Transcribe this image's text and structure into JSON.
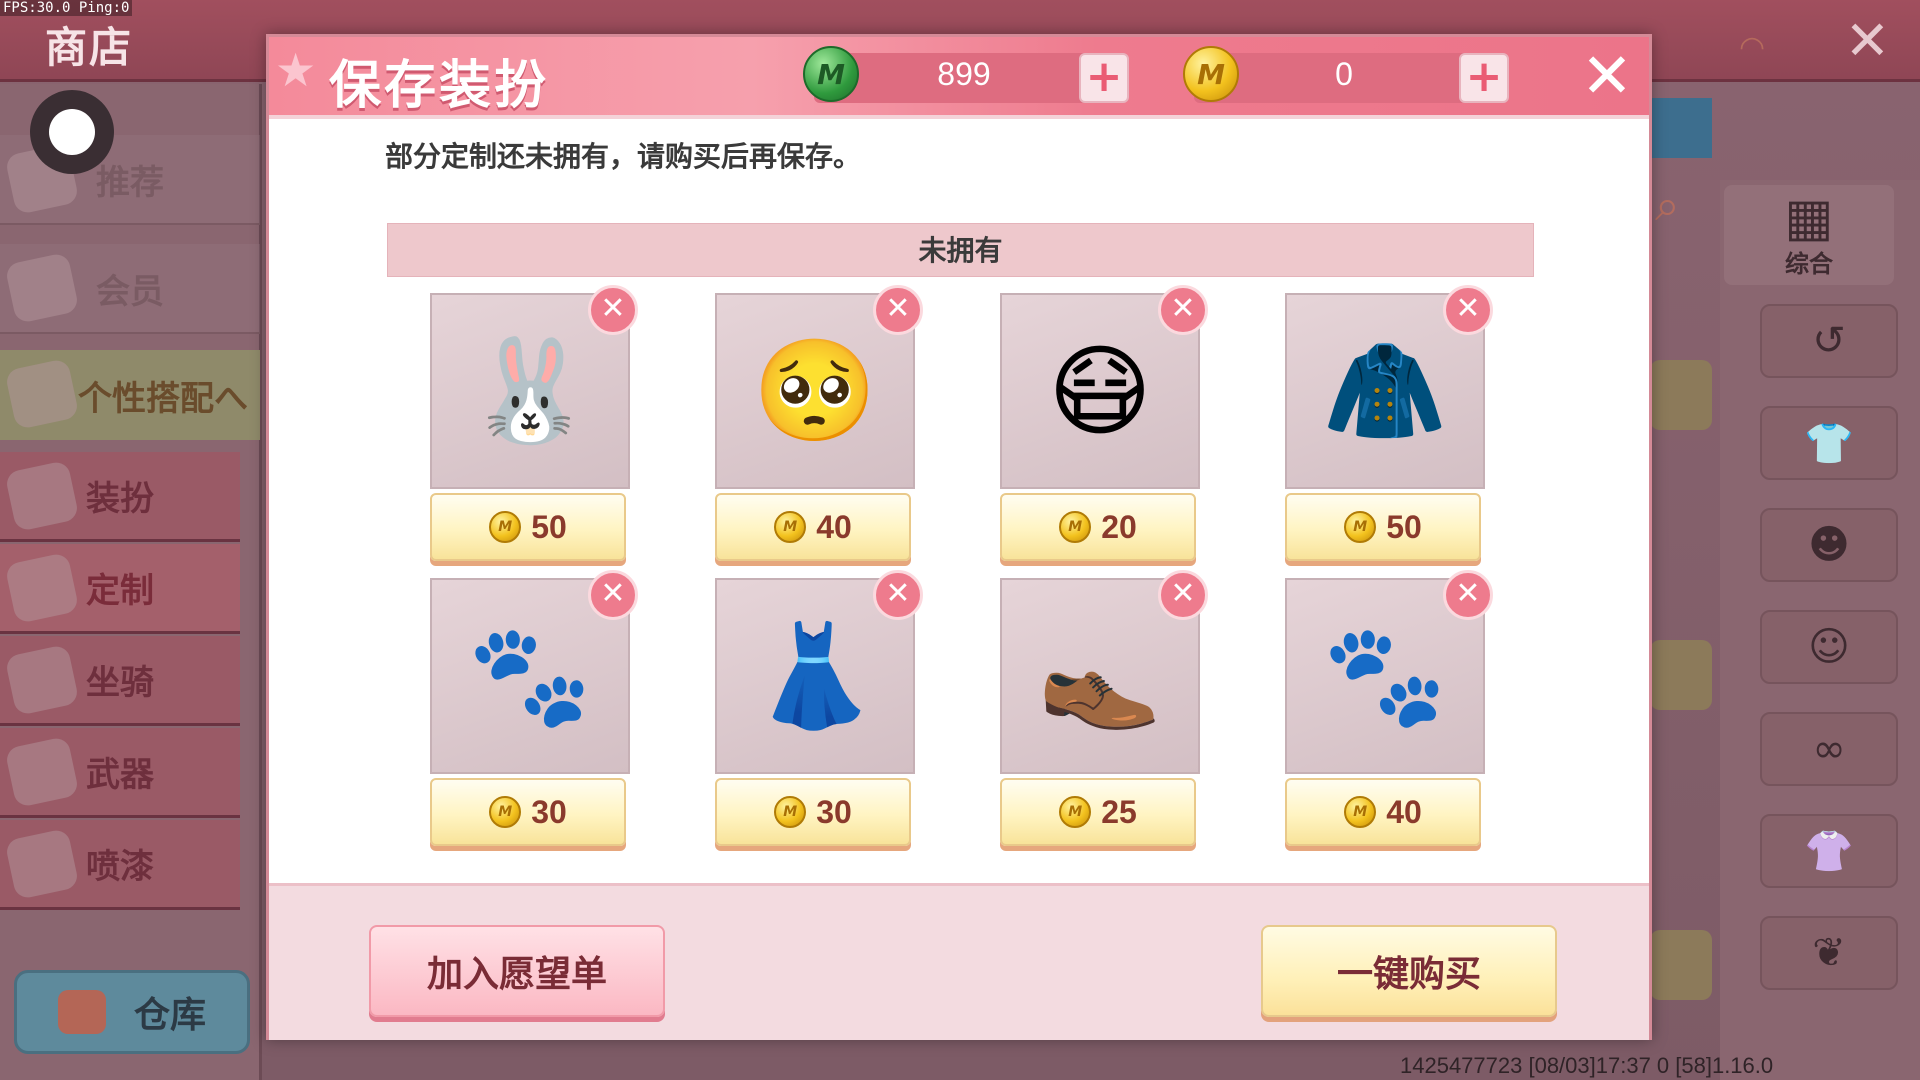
{
  "debug": {
    "fps_text": "FPS:30.0  Ping:0"
  },
  "background": {
    "shop_title": "商店",
    "menu": {
      "recommend": "推荐",
      "member": "会员",
      "personal": "个性搭配へ",
      "dress": "装扮",
      "custom": "定制",
      "mount": "坐骑",
      "weapon": "武器",
      "spray": "喷漆"
    },
    "warehouse": "仓库",
    "right_top_label": "综合",
    "footer_id": "1425477723   [08/03]17:37 0   [58]1.16.0"
  },
  "dialog": {
    "title": "保存装扮",
    "gems": "899",
    "coins": "0",
    "notice": "部分定制还未拥有，请购买后再保存。",
    "section_title": "未拥有",
    "items": [
      {
        "icon": "bunny-hair-icon",
        "glyph": "🐰",
        "price": "50"
      },
      {
        "icon": "face-icon",
        "glyph": "🥺",
        "price": "40"
      },
      {
        "icon": "mask-icon",
        "glyph": "😷",
        "price": "20"
      },
      {
        "icon": "sweater-vest-icon",
        "glyph": "🧥",
        "price": "50"
      },
      {
        "icon": "paw-gloves-icon",
        "glyph": "🐾",
        "price": "30"
      },
      {
        "icon": "plaid-skirt-icon",
        "glyph": "👗",
        "price": "30"
      },
      {
        "icon": "mary-jane-shoes-icon",
        "glyph": "👞",
        "price": "25"
      },
      {
        "icon": "paw-prints-icon",
        "glyph": "🐾",
        "price": "40"
      }
    ],
    "wishlist_label": "加入愿望单",
    "buy_all_label": "一键购买"
  },
  "colors": {
    "header_pink": "#f48a9a",
    "section_bg": "#eec8cc",
    "price_text": "#8a3a2c",
    "remove_badge": "#ee7b8d"
  }
}
